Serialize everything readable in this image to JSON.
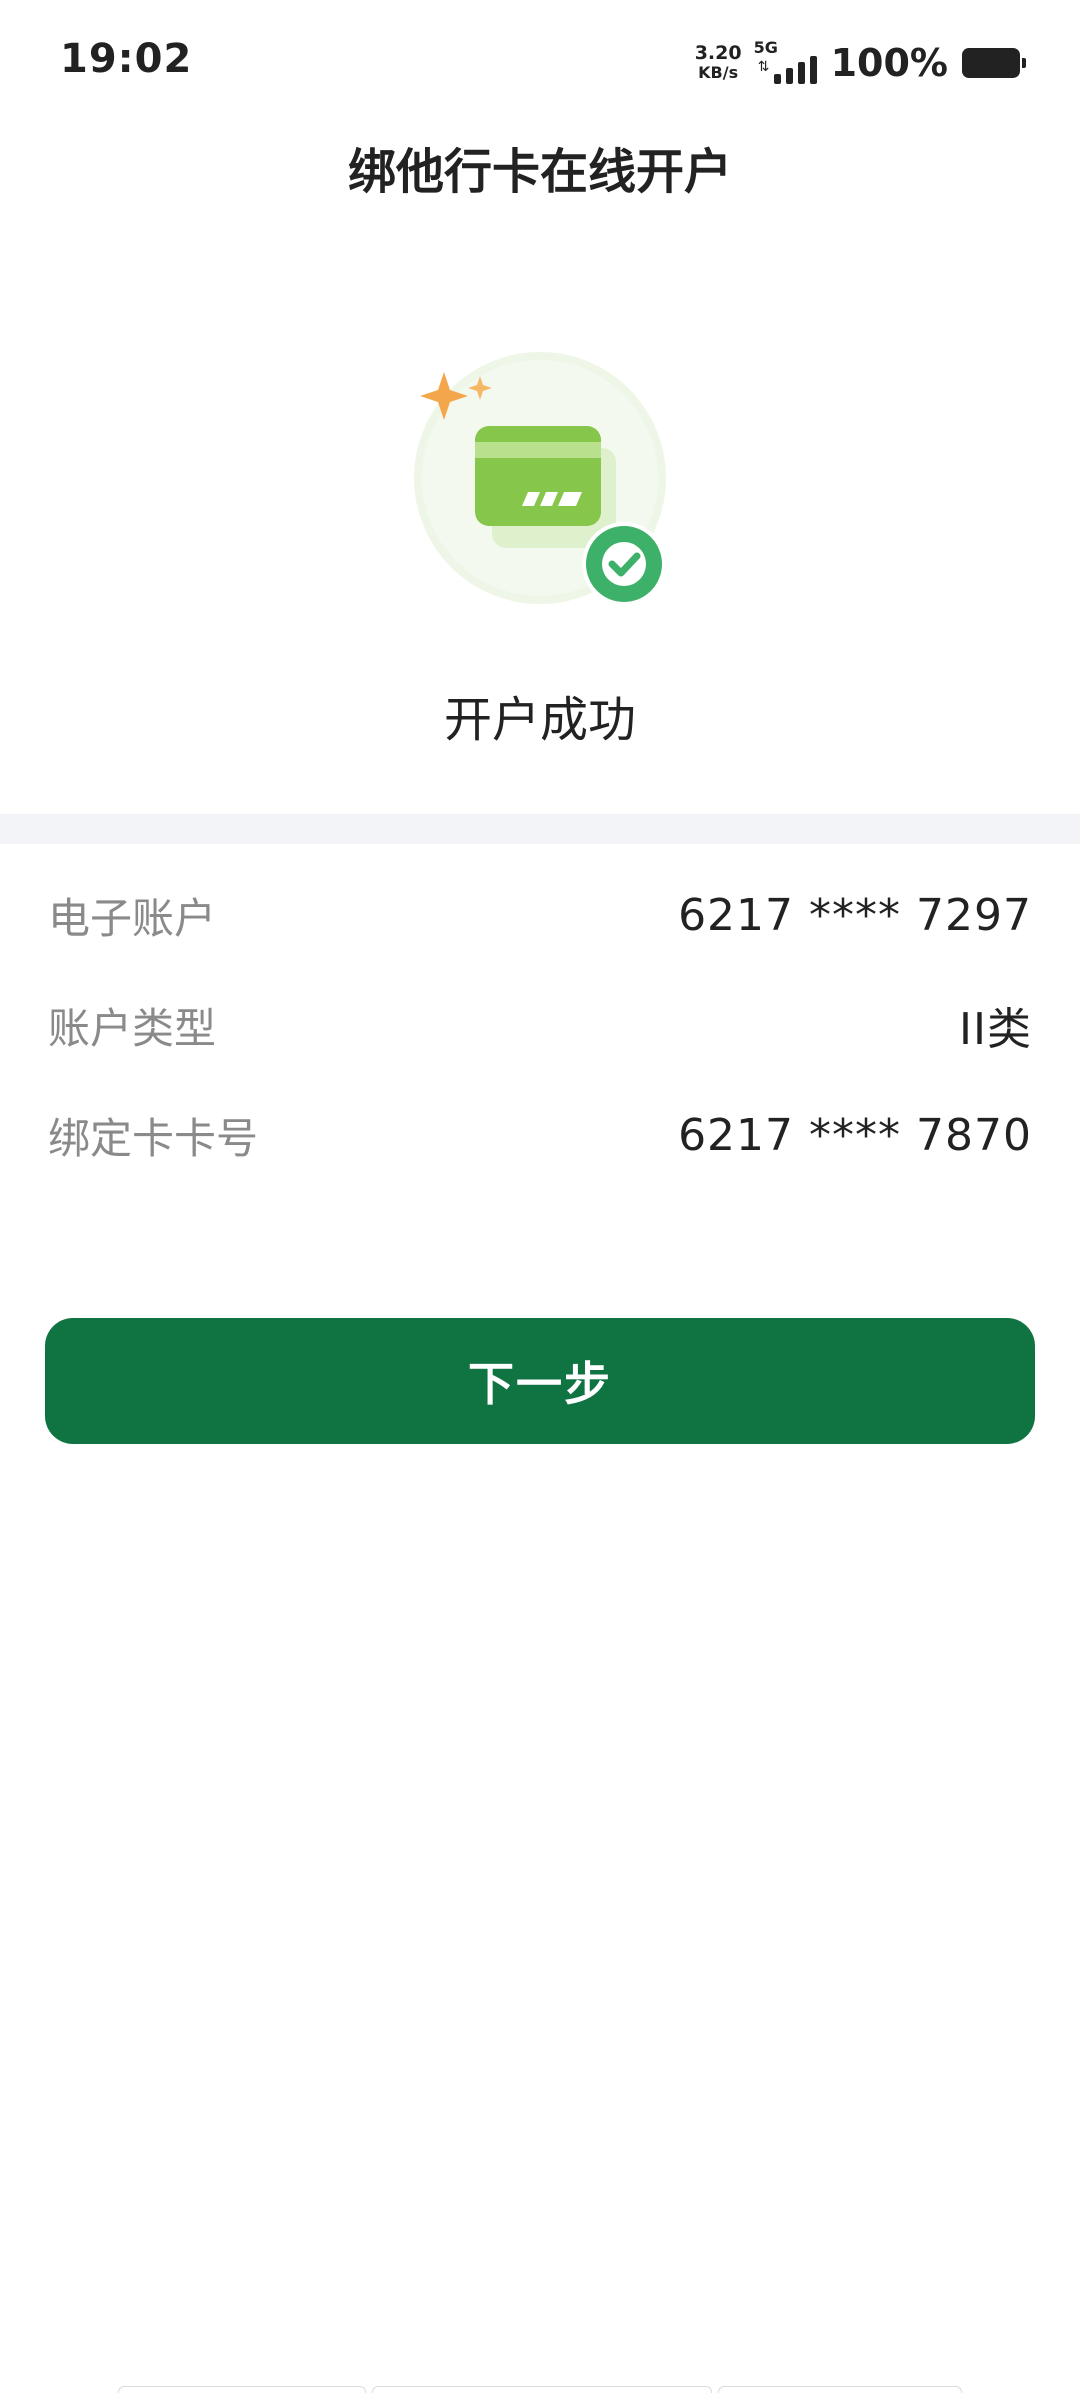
{
  "status_bar": {
    "time": "19:02",
    "net_speed_value": "3.20",
    "net_speed_unit": "KB/s",
    "network": "5G",
    "battery": "100%"
  },
  "header": {
    "title": "绑他行卡在线开户"
  },
  "hero": {
    "icon": "bank-card-success-icon",
    "message": "开户成功"
  },
  "info": {
    "rows": [
      {
        "label": "电子账户",
        "value": "6217 **** 7297"
      },
      {
        "label": "账户类型",
        "value": "II类"
      },
      {
        "label": "绑定卡卡号",
        "value": "6217 **** 7870"
      }
    ]
  },
  "actions": {
    "next_label": "下一步"
  },
  "colors": {
    "primary": "#107342",
    "card_green": "#8cc84b",
    "check_green": "#3db06a",
    "sparkle": "#f3a64a",
    "band": "#f3f4f7"
  }
}
